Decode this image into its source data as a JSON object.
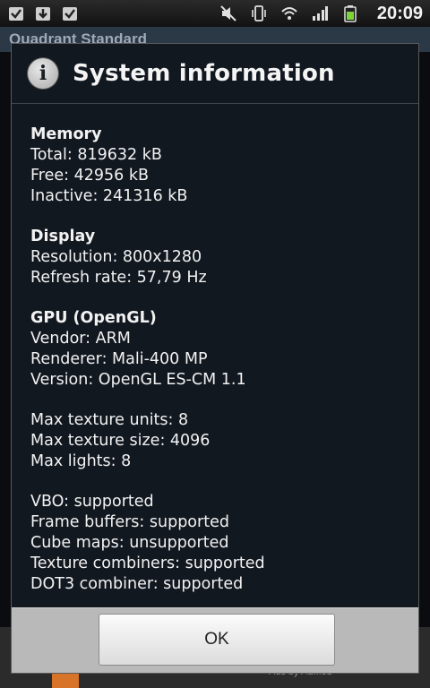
{
  "status_bar": {
    "time": "20:09",
    "left_icons": [
      "checkbox-icon",
      "download-icon",
      "checkbox-icon"
    ],
    "right_icons": [
      "mute-icon",
      "vibrate-icon",
      "wifi-icon",
      "signal-icon",
      "battery-icon"
    ]
  },
  "background_app": {
    "title": "Quadrant Standard",
    "ad_text": "Ads by AdMob"
  },
  "dialog": {
    "title": "System information",
    "icon": "info-icon",
    "sections": {
      "memory": {
        "title": "Memory",
        "total": "Total: 819632 kB",
        "free": "Free: 42956 kB",
        "inactive": "Inactive: 241316 kB"
      },
      "display": {
        "title": "Display",
        "resolution": "Resolution: 800x1280",
        "refresh": "Refresh rate: 57,79 Hz"
      },
      "gpu": {
        "title": "GPU (OpenGL)",
        "vendor": "Vendor: ARM",
        "renderer": "Renderer: Mali-400 MP",
        "version": "Version: OpenGL ES-CM 1.1"
      },
      "limits": {
        "texture_units": "Max texture units: 8",
        "texture_size": "Max texture size: 4096",
        "lights": "Max lights: 8"
      },
      "features": {
        "vbo": "VBO: supported",
        "frame_buffers": "Frame buffers: supported",
        "cube_maps": "Cube maps: unsupported",
        "texture_combiners": "Texture combiners: supported",
        "dot3": "DOT3 combiner: supported"
      }
    },
    "ok_label": "OK"
  },
  "colors": {
    "dialog_bg": "#121820",
    "app_bar": "#2b3846",
    "battery": "#7dd33a"
  }
}
